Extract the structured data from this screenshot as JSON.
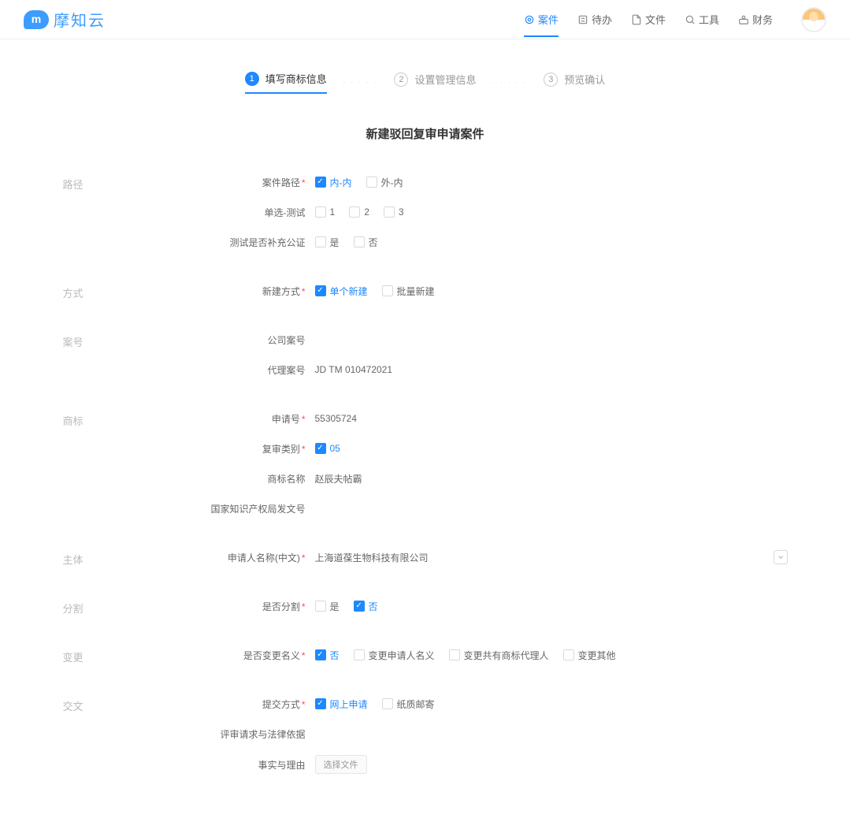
{
  "header": {
    "logo_text": "摩知云",
    "nav": [
      {
        "label": "案件",
        "active": true
      },
      {
        "label": "待办",
        "active": false
      },
      {
        "label": "文件",
        "active": false
      },
      {
        "label": "工具",
        "active": false
      },
      {
        "label": "财务",
        "active": false
      }
    ]
  },
  "steps": [
    {
      "num": "1",
      "label": "填写商标信息",
      "active": true
    },
    {
      "num": "2",
      "label": "设置管理信息",
      "active": false
    },
    {
      "num": "3",
      "label": "预览确认",
      "active": false
    }
  ],
  "page_title": "新建驳回复审申请案件",
  "sections": {
    "path": {
      "title": "路径",
      "rows": {
        "case_path": {
          "label": "案件路径",
          "required": true,
          "options": [
            {
              "label": "内-内",
              "checked": true
            },
            {
              "label": "外-内",
              "checked": false
            }
          ]
        },
        "single_test": {
          "label": "单选-测试",
          "required": false,
          "options": [
            {
              "label": "1",
              "checked": false
            },
            {
              "label": "2",
              "checked": false
            },
            {
              "label": "3",
              "checked": false
            }
          ]
        },
        "supplement": {
          "label": "测试是否补充公证",
          "required": false,
          "options": [
            {
              "label": "是",
              "checked": false
            },
            {
              "label": "否",
              "checked": false
            }
          ]
        }
      }
    },
    "method": {
      "title": "方式",
      "rows": {
        "new_method": {
          "label": "新建方式",
          "required": true,
          "options": [
            {
              "label": "单个新建",
              "checked": true
            },
            {
              "label": "批量新建",
              "checked": false
            }
          ]
        }
      }
    },
    "case_no": {
      "title": "案号",
      "rows": {
        "company_no": {
          "label": "公司案号",
          "value": ""
        },
        "agent_no": {
          "label": "代理案号",
          "value": "JD TM 010472021"
        }
      }
    },
    "trademark": {
      "title": "商标",
      "rows": {
        "app_no": {
          "label": "申请号",
          "required": true,
          "value": "55305724"
        },
        "review_type": {
          "label": "复审类别",
          "required": true,
          "options": [
            {
              "label": "05",
              "checked": true
            }
          ]
        },
        "tm_name": {
          "label": "商标名称",
          "value": "赵辰夫帖霸"
        },
        "doc_no": {
          "label": "国家知识产权局发文号",
          "value": ""
        }
      }
    },
    "entity": {
      "title": "主体",
      "rows": {
        "applicant_cn": {
          "label": "申请人名称(中文)",
          "required": true,
          "value": "上海道葆生物科技有限公司"
        }
      }
    },
    "split": {
      "title": "分割",
      "rows": {
        "is_split": {
          "label": "是否分割",
          "required": true,
          "options": [
            {
              "label": "是",
              "checked": false
            },
            {
              "label": "否",
              "checked": true
            }
          ]
        }
      }
    },
    "change": {
      "title": "变更",
      "rows": {
        "change_name": {
          "label": "是否变更名义",
          "required": true,
          "options": [
            {
              "label": "否",
              "checked": true
            },
            {
              "label": "变更申请人名义",
              "checked": false
            },
            {
              "label": "变更共有商标代理人",
              "checked": false
            },
            {
              "label": "变更其他",
              "checked": false
            }
          ]
        }
      }
    },
    "submit": {
      "title": "交文",
      "rows": {
        "submit_method": {
          "label": "提交方式",
          "required": true,
          "options": [
            {
              "label": "网上申请",
              "checked": true
            },
            {
              "label": "纸质邮寄",
              "checked": false
            }
          ]
        },
        "review_request": {
          "label": "评审请求与法律依据",
          "value": ""
        },
        "facts": {
          "label": "事实与理由",
          "button": "选择文件"
        }
      }
    }
  }
}
